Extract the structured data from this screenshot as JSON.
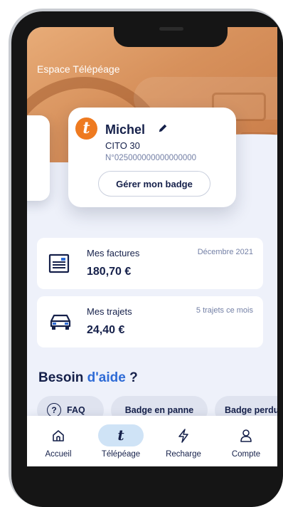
{
  "header": {
    "title": "Espace Télépéage"
  },
  "badge": {
    "logo_letter": "t",
    "owner_name": "Michel",
    "vehicle_model": "CITO 30",
    "badge_number": "N°025000000000000000",
    "manage_button_label": "Gérer mon badge"
  },
  "invoices": {
    "label": "Mes factures",
    "amount": "180,70 €",
    "period": "Décembre 2021"
  },
  "trips": {
    "label": "Mes trajets",
    "amount": "24,40 €",
    "count_text": "5 trajets ce mois"
  },
  "help": {
    "title_part1": "Besoin",
    "title_part2": "d'aide",
    "title_part3": "?",
    "chips": [
      {
        "label": "FAQ",
        "icon_text": "?"
      },
      {
        "label": "Badge en panne"
      },
      {
        "label": "Badge perdu"
      }
    ]
  },
  "tabs": [
    {
      "label": "Accueil",
      "icon": "home-icon"
    },
    {
      "label": "Télépéage",
      "icon": "telepeage-icon",
      "active": true,
      "glyph": "t"
    },
    {
      "label": "Recharge",
      "icon": "lightning-icon"
    },
    {
      "label": "Compte",
      "icon": "user-icon"
    }
  ],
  "colors": {
    "navy": "#15204a",
    "accent_blue": "#2e6bd6",
    "brand_orange": "#ee7a20",
    "active_tab_pill": "#cfe3f6",
    "chip_bg": "#dfe3ef"
  }
}
